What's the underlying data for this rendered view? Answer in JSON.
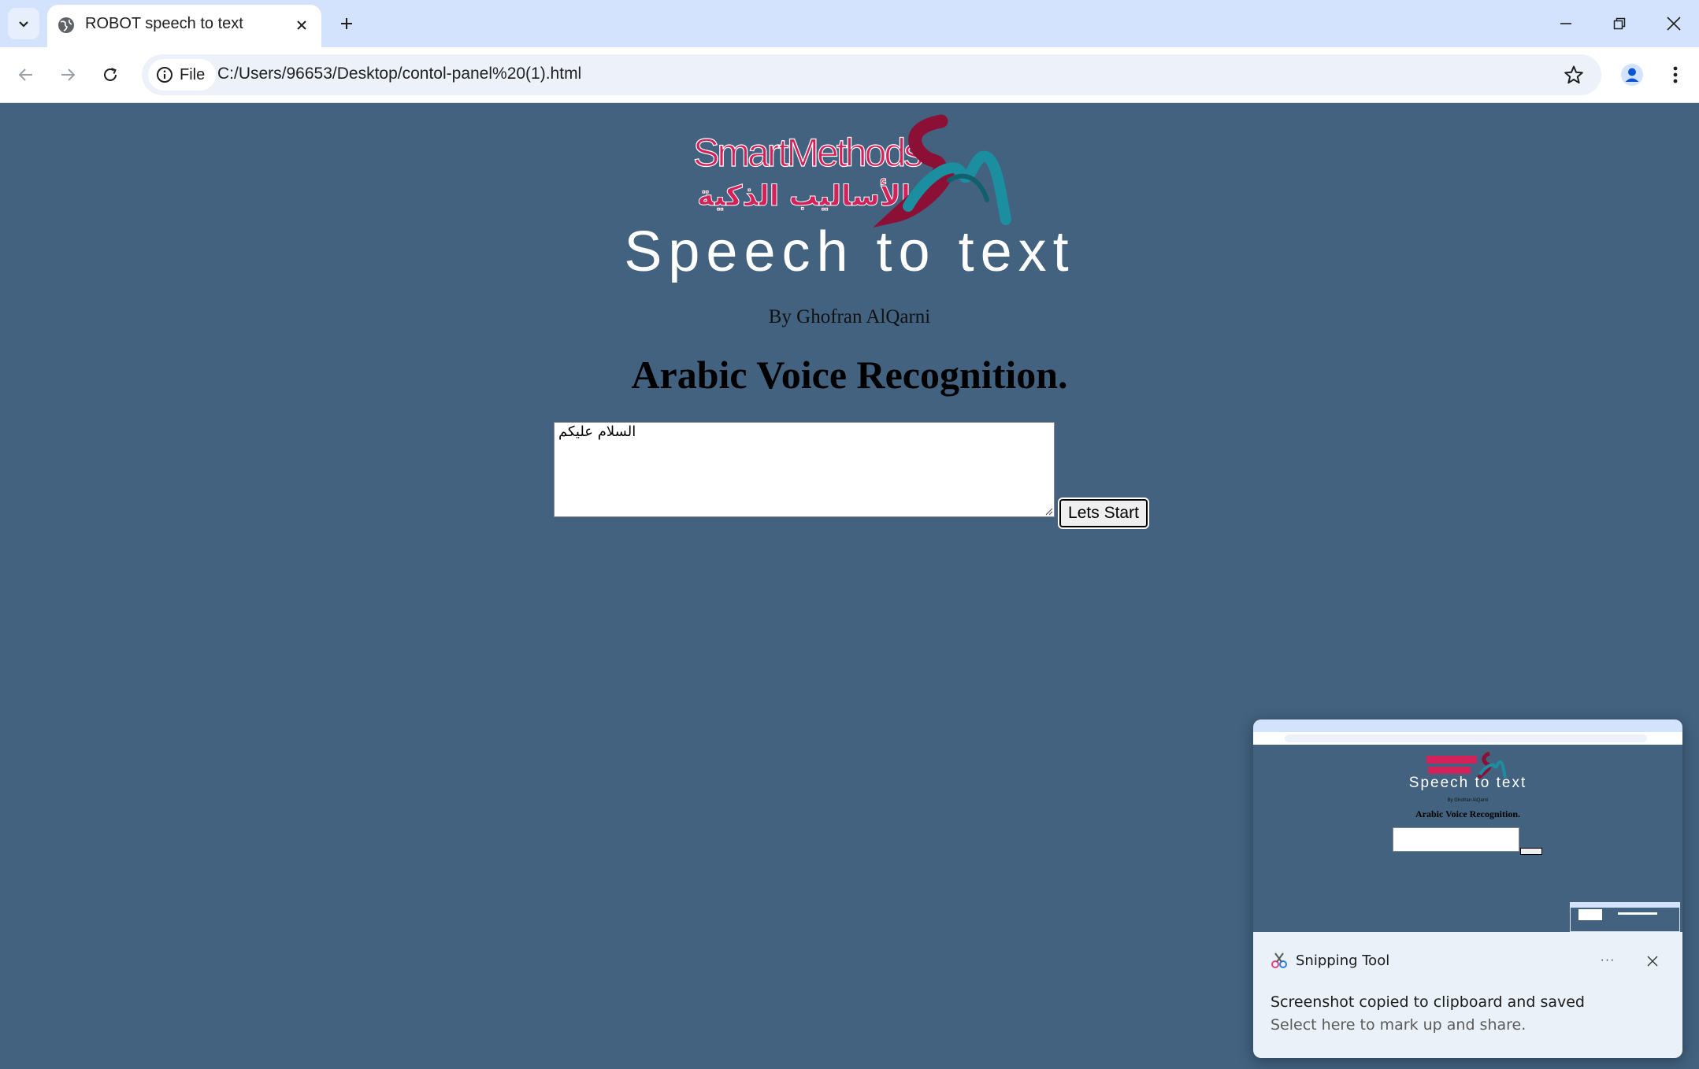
{
  "browser": {
    "tab_title": "ROBOT speech to text",
    "site_chip_label": "File",
    "url": "C:/Users/96653/Desktop/contol-panel%20(1).html"
  },
  "logo": {
    "latin": "SmartMethods",
    "arabic": "الأساليب الذكية"
  },
  "page": {
    "title": "Speech to text",
    "author": "By Ghofran AlQarni",
    "subtitle": "Arabic Voice Recognition.",
    "textarea_value": "السلام  عليكم",
    "start_button_label": "Lets Start"
  },
  "toast": {
    "app_name": "Snipping Tool",
    "more_label": "···",
    "message": "Screenshot copied to clipboard and saved",
    "hint": "Select here to mark up and share."
  },
  "colors": {
    "page_background": "#42627f",
    "tabstrip": "#d3e3fd",
    "logo_pink": "#d3215a",
    "logo_teal": "#1b8ea0",
    "logo_maroon": "#8c1036"
  }
}
